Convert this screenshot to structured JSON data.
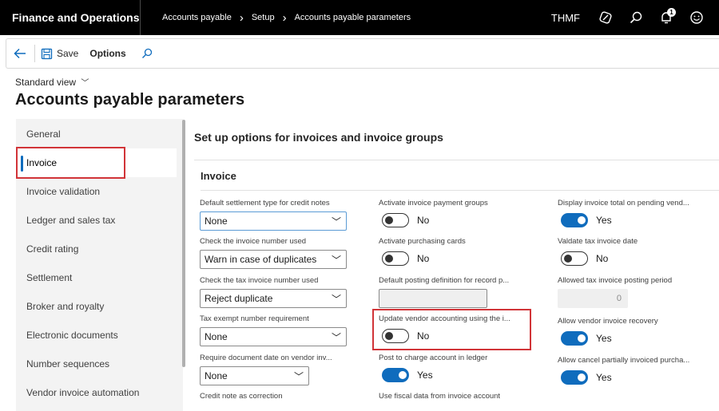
{
  "topbar": {
    "app_title": "Finance and Operations",
    "breadcrumb": [
      "Accounts payable",
      "Setup",
      "Accounts payable parameters"
    ],
    "company": "THMF",
    "notification_count": "1",
    "icons": [
      "dynamics-icon",
      "search-icon",
      "bell-icon",
      "smiley-icon"
    ]
  },
  "actionbar": {
    "save_label": "Save",
    "options_label": "Options",
    "icons": [
      "back-arrow-icon",
      "save-icon",
      "search-icon"
    ]
  },
  "page": {
    "view_selector": "Standard view",
    "title": "Accounts payable parameters"
  },
  "sidebar": {
    "active_index": 1,
    "items": [
      "General",
      "Invoice",
      "Invoice validation",
      "Ledger and sales tax",
      "Credit rating",
      "Settlement",
      "Broker and royalty",
      "Electronic documents",
      "Number sequences",
      "Vendor invoice automation"
    ]
  },
  "main": {
    "section_title": "Set up options for invoices and invoice groups",
    "group_title": "Invoice",
    "col1": [
      {
        "label": "Default settlement type for credit notes",
        "value": "None"
      },
      {
        "label": "Check the invoice number used",
        "value": "Warn in case of duplicates"
      },
      {
        "label": "Check the tax invoice number used",
        "value": "Reject duplicate"
      },
      {
        "label": "Tax exempt number requirement",
        "value": "None"
      },
      {
        "label": "Require document date on vendor inv...",
        "value": "None"
      },
      {
        "label": "Credit note as correction"
      }
    ],
    "col2": [
      {
        "label": "Activate invoice payment groups",
        "value": "No"
      },
      {
        "label": "Activate purchasing cards",
        "value": "No"
      },
      {
        "label": "Default posting definition for record p...",
        "value": ""
      },
      {
        "label": "Update vendor accounting using the i...",
        "value": "No"
      },
      {
        "label": "Post to charge account in ledger",
        "value": "Yes"
      },
      {
        "label": "Use fiscal data from invoice account"
      }
    ],
    "col3": [
      {
        "label": "Display invoice total on pending vend...",
        "value": "Yes"
      },
      {
        "label": "Valdate tax invoice date",
        "value": "No"
      },
      {
        "label": "Allowed tax invoice posting period",
        "value": "0"
      },
      {
        "label": "Allow vendor invoice recovery",
        "value": "Yes"
      },
      {
        "label": "Allow cancel partially invoiced purcha...",
        "value": "Yes"
      }
    ]
  },
  "colors": {
    "accent": "#0f6cbd",
    "highlight": "#d13438",
    "topbar": "#000000",
    "sidebar_bg": "#f3f3f3"
  }
}
